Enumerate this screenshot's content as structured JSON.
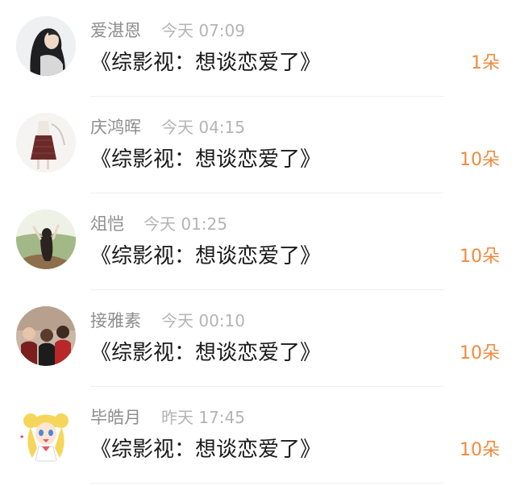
{
  "items": [
    {
      "name": "爱湛恩",
      "time": "今天 07:09",
      "message": "《综影视：想谈恋爱了》",
      "flowers": "1朵",
      "avatar_icon": "avatar-woman-long-hair"
    },
    {
      "name": "庆鸿晖",
      "time": "今天 04:15",
      "message": "《综影视：想谈恋爱了》",
      "flowers": "10朵",
      "avatar_icon": "avatar-skirt-illustration"
    },
    {
      "name": "俎恺",
      "time": "今天 01:25",
      "message": "《综影视：想谈恋爱了》",
      "flowers": "10朵",
      "avatar_icon": "avatar-girl-in-field"
    },
    {
      "name": "接雅素",
      "time": "今天 00:10",
      "message": "《综影视：想谈恋爱了》",
      "flowers": "10朵",
      "avatar_icon": "avatar-group-photo"
    },
    {
      "name": "毕皓月",
      "time": "昨天 17:45",
      "message": "《综影视：想谈恋爱了》",
      "flowers": "10朵",
      "avatar_icon": "avatar-anime-girl"
    }
  ],
  "colors": {
    "name": "#8e8e8e",
    "time": "#b4b4b4",
    "message": "#1a1a1a",
    "flowers": "#f08a3c",
    "divider": "#efefef"
  }
}
